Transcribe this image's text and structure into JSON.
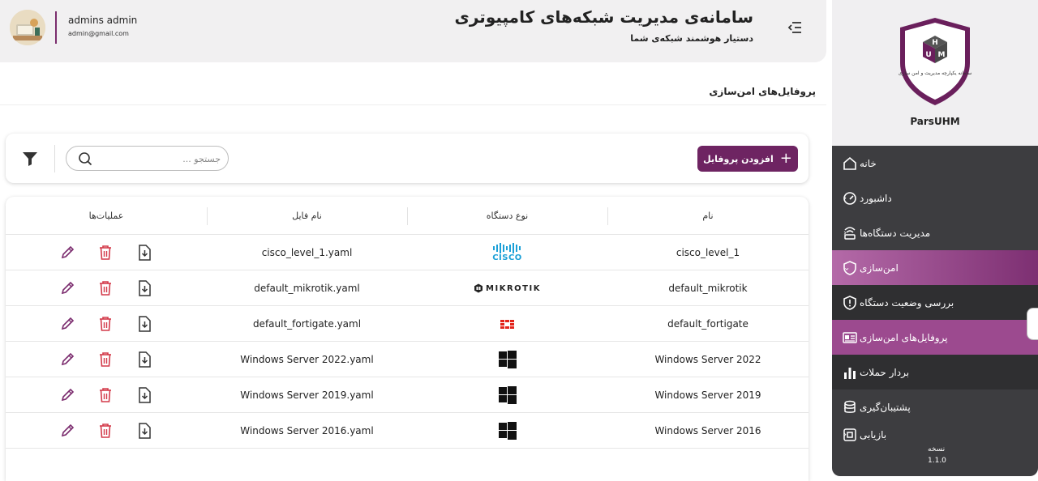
{
  "header": {
    "title": "سامانه‌ی مدیریت شبکه‌های کامپیوتری",
    "subtitle": "دستیار هوشمند شبکه‌ی شما",
    "user_name": "admins admin",
    "user_email": "admin@gmail.com"
  },
  "sidebar": {
    "brand": "ParsUHM",
    "logo_text": "سامانه یکپارچه مدیریت و امن سازی",
    "items": [
      {
        "label": "خانه",
        "icon": "home-icon"
      },
      {
        "label": "داشبورد",
        "icon": "gauge-icon"
      },
      {
        "label": "مدیریت دستگاه‌ها",
        "icon": "router-icon"
      },
      {
        "label": "امن‌سازی",
        "icon": "shield-icon"
      },
      {
        "label": "بررسی وضعیت دستگاه",
        "icon": "shield-alert-icon"
      },
      {
        "label": "پروفایل‌های امن‌سازی",
        "icon": "profile-card-icon"
      },
      {
        "label": "بردار حملات",
        "icon": "bar-chart-icon"
      },
      {
        "label": "پشتیبان‌گیری",
        "icon": "database-icon"
      },
      {
        "label": "بازیابی",
        "icon": "restore-icon"
      }
    ],
    "version_label": "نسخه",
    "version": "1.1.0"
  },
  "page": {
    "title": "پروفایل‌های امن‌سازی"
  },
  "toolbar": {
    "add_label": "افزودن پروفایل",
    "search_placeholder": "جستجو ..."
  },
  "table": {
    "headers": {
      "name": "نام",
      "device_type": "نوع دستگاه",
      "file_name": "نام فایل",
      "actions": "عملیات‌ها"
    },
    "rows": [
      {
        "name": "cisco_level_1",
        "device": "cisco",
        "file": "cisco_level_1.yaml"
      },
      {
        "name": "default_mikrotik",
        "device": "mikrotik",
        "file": "default_mikrotik.yaml"
      },
      {
        "name": "default_fortigate",
        "device": "fortigate",
        "file": "default_fortigate.yaml"
      },
      {
        "name": "Windows Server 2022",
        "device": "windows",
        "file": "Windows Server 2022.yaml"
      },
      {
        "name": "Windows Server 2019",
        "device": "windows",
        "file": "Windows Server 2019.yaml"
      },
      {
        "name": "Windows Server 2016",
        "device": "windows",
        "file": "Windows Server 2016.yaml"
      }
    ]
  },
  "brands": {
    "cisco_text": "CISCO",
    "mikrotik_text": "MIKROTIK"
  },
  "colors": {
    "primary": "#6e2462",
    "sidebar_bg": "#3d3d40",
    "delete": "#d33a4a"
  }
}
